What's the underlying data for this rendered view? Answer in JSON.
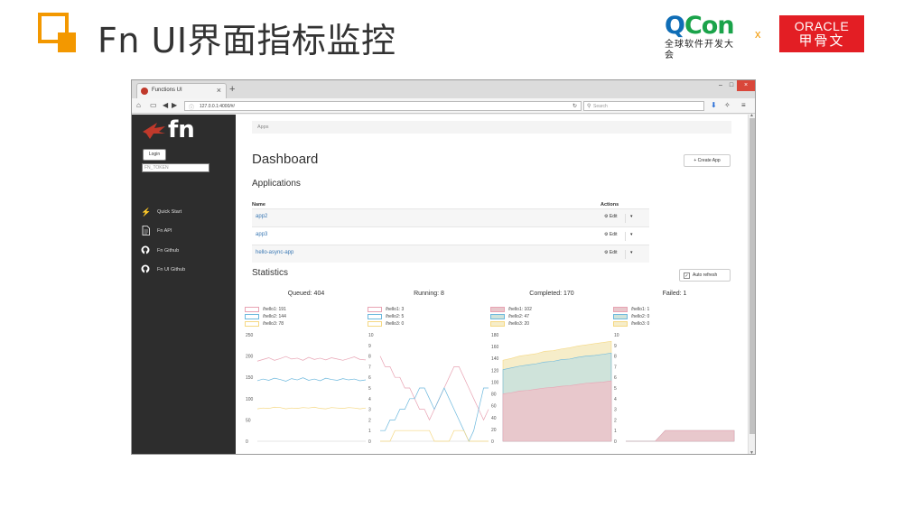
{
  "slide": {
    "title": "Fn UI界面指标监控",
    "qcon": {
      "logo_q": "Q",
      "logo_rest": "Con",
      "subtitle": "全球软件开发大会"
    },
    "separator": "x",
    "oracle": {
      "line1": "ORACLE",
      "line2": "甲骨文"
    },
    "accent_color": "#f39800"
  },
  "browser": {
    "tab_title": "Functions UI",
    "tab_close": "×",
    "new_tab": "+",
    "url": "127.0.0.1:4000/#/",
    "search_placeholder": "Search",
    "window_controls": [
      "–",
      "□",
      "×"
    ]
  },
  "sidebar": {
    "logo_text": "fn",
    "login_label": "Login",
    "token_placeholder": "FN_TOKEN",
    "items": [
      {
        "icon": "lightning-icon",
        "glyph": "⚡",
        "label": "Quick Start"
      },
      {
        "icon": "document-icon",
        "glyph": "🗎",
        "label": "Fn API"
      },
      {
        "icon": "github-icon",
        "glyph": "●",
        "label": "Fn Github"
      },
      {
        "icon": "github-icon",
        "glyph": "●",
        "label": "Fn UI Github"
      }
    ]
  },
  "main": {
    "breadcrumb": "Apps",
    "title": "Dashboard",
    "create_app_label": "+ Create App",
    "applications_title": "Applications",
    "columns": {
      "name": "Name",
      "actions": "Actions"
    },
    "apps": [
      {
        "name": "app2",
        "edit_label": "⚙ Edit",
        "caret": "▾"
      },
      {
        "name": "app3",
        "edit_label": "⚙ Edit",
        "caret": "▾"
      },
      {
        "name": "hello-async-app",
        "edit_label": "⚙ Edit",
        "caret": "▾"
      }
    ],
    "statistics_title": "Statistics",
    "auto_refresh_label": "Auto refresh",
    "auto_refresh_checked": "✓"
  },
  "colors": {
    "hello1": "#e8a3b3",
    "hello2": "#6cb8dd",
    "hello3": "#f5d883",
    "hello1_fill": "#e8c8cc",
    "hello2_fill": "#cfe3da",
    "hello3_fill": "#f6edc9"
  },
  "chart_data": [
    {
      "type": "line",
      "title": "Queued: 404",
      "legend": [
        "/hello1: 191",
        "/hello2: 144",
        "/hello3: 78"
      ],
      "yticks": [
        0,
        50,
        100,
        150,
        200,
        250
      ],
      "ylim": [
        0,
        250
      ],
      "series": [
        {
          "name": "/hello1: 191",
          "values": [
            188,
            192,
            196,
            190,
            194,
            199,
            193,
            195,
            190,
            197,
            192,
            195,
            191,
            196,
            193,
            190,
            194,
            198,
            192,
            191
          ]
        },
        {
          "name": "/hello2: 144",
          "values": [
            142,
            146,
            143,
            148,
            145,
            141,
            147,
            144,
            149,
            143,
            146,
            142,
            148,
            145,
            143,
            147,
            144,
            146,
            142,
            144
          ]
        },
        {
          "name": "/hello3: 78",
          "values": [
            76,
            78,
            77,
            80,
            79,
            76,
            78,
            77,
            79,
            78,
            80,
            77,
            76,
            79,
            78,
            77,
            79,
            78,
            76,
            78
          ]
        }
      ]
    },
    {
      "type": "line",
      "title": "Running: 8",
      "legend": [
        "/hello1: 3",
        "/hello2: 5",
        "/hello3: 0"
      ],
      "yticks": [
        0,
        1,
        2,
        3,
        4,
        5,
        6,
        7,
        8,
        9,
        10
      ],
      "ylim": [
        0,
        10
      ],
      "series": [
        {
          "name": "/hello1: 3",
          "values": [
            8,
            7,
            7,
            6,
            6,
            5,
            5,
            4,
            3,
            3,
            2,
            3,
            4,
            5,
            6,
            7,
            7,
            6,
            5,
            4,
            3,
            2,
            3
          ]
        },
        {
          "name": "/hello2: 5",
          "values": [
            1,
            1,
            2,
            2,
            3,
            3,
            4,
            4,
            5,
            5,
            4,
            3,
            4,
            5,
            4,
            3,
            2,
            1,
            0,
            1,
            3,
            5,
            5
          ]
        },
        {
          "name": "/hello3: 0",
          "values": [
            0,
            0,
            0,
            1,
            1,
            1,
            1,
            1,
            1,
            1,
            1,
            0,
            0,
            0,
            0,
            1,
            1,
            1,
            0,
            0,
            0,
            0,
            0
          ]
        }
      ]
    },
    {
      "type": "area",
      "title": "Completed: 170",
      "legend": [
        "/hello1: 102",
        "/hello2: 47",
        "/hello3: 20"
      ],
      "yticks": [
        0,
        20,
        40,
        60,
        80,
        100,
        120,
        140,
        160,
        180
      ],
      "ylim": [
        0,
        180
      ],
      "series": [
        {
          "name": "/hello1: 102",
          "values": [
            80,
            82,
            85,
            86,
            88,
            90,
            91,
            93,
            94,
            96,
            98,
            99,
            100,
            102
          ]
        },
        {
          "name": "/hello2: 47",
          "values": [
            41,
            42,
            42,
            43,
            43,
            44,
            44,
            45,
            45,
            46,
            46,
            46,
            47,
            47
          ]
        },
        {
          "name": "/hello3: 20",
          "values": [
            16,
            16,
            17,
            17,
            17,
            18,
            18,
            18,
            19,
            19,
            19,
            20,
            20,
            20
          ]
        }
      ]
    },
    {
      "type": "area",
      "title": "Failed: 1",
      "legend": [
        "/hello1: 1",
        "/hello2: 0",
        "/hello3: 0"
      ],
      "yticks": [
        0,
        1,
        2,
        3,
        4,
        5,
        6,
        7,
        8,
        9,
        10
      ],
      "ylim": [
        0,
        10
      ],
      "series": [
        {
          "name": "/hello1: 1",
          "values": [
            0,
            0,
            0,
            0,
            1,
            1,
            1,
            1,
            1,
            1,
            1,
            1
          ]
        },
        {
          "name": "/hello2: 0",
          "values": [
            0,
            0,
            0,
            0,
            0,
            0,
            0,
            0,
            0,
            0,
            0,
            0
          ]
        },
        {
          "name": "/hello3: 0",
          "values": [
            0,
            0,
            0,
            0,
            0,
            0,
            0,
            0,
            0,
            0,
            0,
            0
          ]
        }
      ]
    }
  ]
}
